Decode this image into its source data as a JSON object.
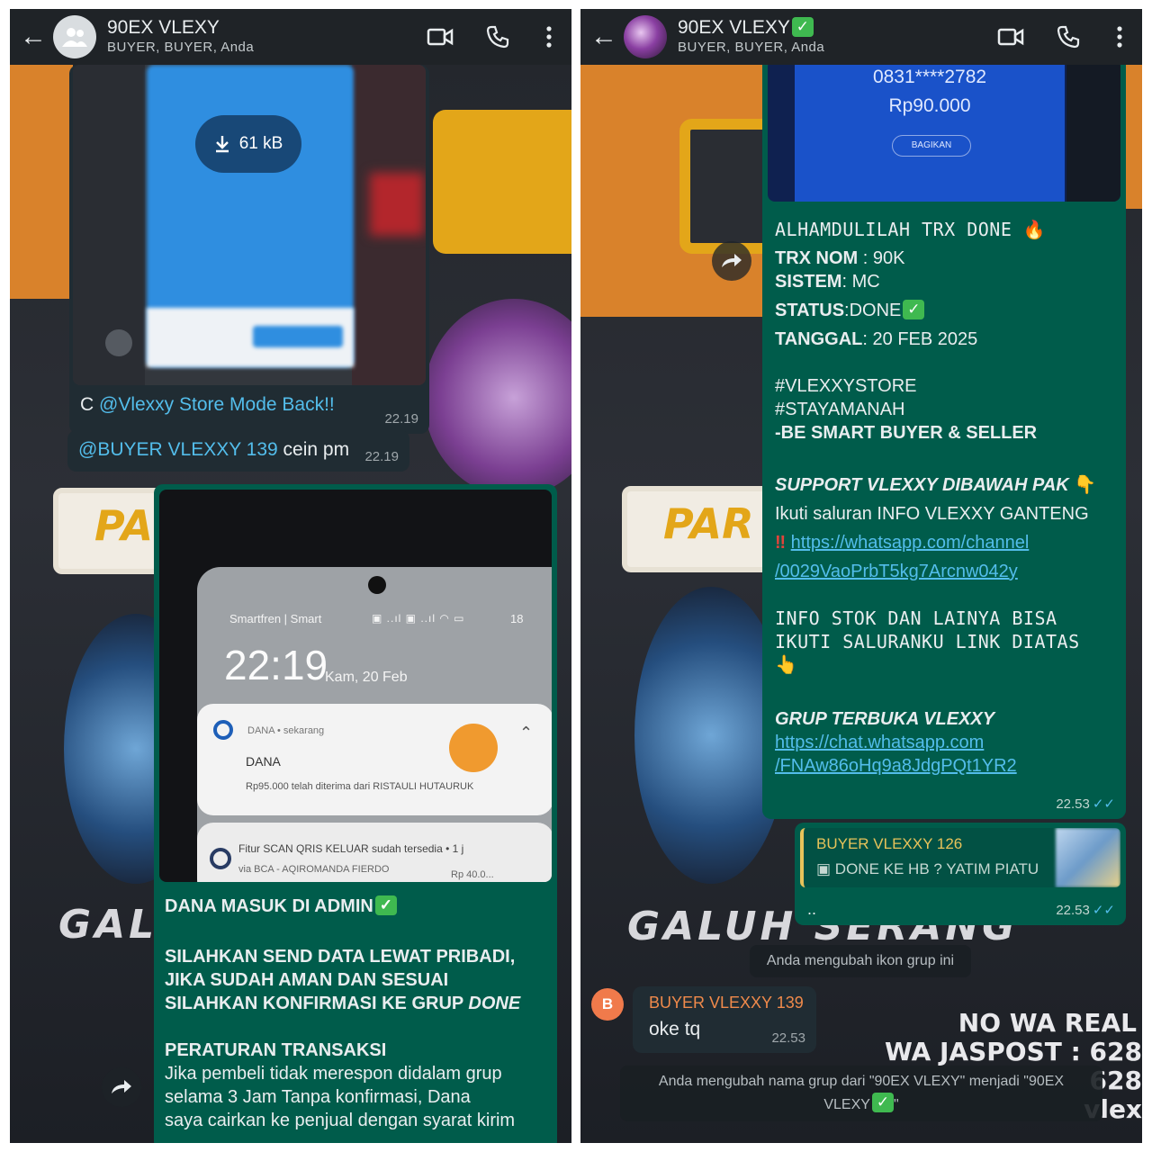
{
  "left": {
    "header": {
      "title": "90EX VLEXY",
      "subtitle": "BUYER, BUYER, Anda"
    },
    "messages": {
      "image_download_size": "61 kB",
      "caption_prefix": "C ",
      "caption_mention": "@Vlexxy Store Mode Back!!",
      "caption_time": "22.19",
      "m2_mention": "@BUYER VLEXXY 139",
      "m2_text": " cein pm",
      "m2_time": "22.19"
    },
    "screenshot": {
      "carrier": "Smartfren | Smart",
      "battery": "18",
      "clock": "22:19",
      "date": "Kam, 20 Feb",
      "notif1_app": "DANA • sekarang",
      "notif1_title": "DANA",
      "notif1_body": "Rp95.000 telah diterima dari RISTAULI HUTAURUK",
      "notif2_title": "Fitur SCAN QRIS KELUAR sudah tersedia",
      "notif2_meta": "• 1 j",
      "notif2_body": "via BCA - AQIROMANDA FIERDO",
      "notif2_amount": "Rp 40.0..."
    },
    "caption": {
      "line1": "DANA MASUK DI ADMIN",
      "line2": "SILAHKAN SEND DATA LEWAT PRIBADI,",
      "line3": "JIKA SUDAH AMAN DAN SESUAI",
      "line4a": "SILAHKAN KONFIRMASI KE GRUP ",
      "line4b": "DONE",
      "line5": "PERATURAN TRANSAKSI",
      "line6": "Jika pembeli tidak merespon didalam grup",
      "line7": "selama 3 Jam Tanpa konfirmasi, Dana",
      "line8": "saya cairkan ke penjual dengan syarat kirim"
    },
    "wallpaper": {
      "banner": "PAR",
      "big": "GALU"
    }
  },
  "right": {
    "header": {
      "title": "90EX VLEXY",
      "subtitle": "BUYER, BUYER, Anda"
    },
    "receipt": {
      "phone": "0831****2782",
      "amount": "Rp90.000",
      "share": "BAGIKAN"
    },
    "post": {
      "l1": "ALHAMDULILAH TRX DONE",
      "trx_label": "TRX NOM",
      "trx_val": " : 90K",
      "sistem_label": "SISTEM",
      "sistem_val": ": MC",
      "status_label": "STATUS",
      "status_val": ":DONE",
      "tanggal_label": "TANGGAL",
      "tanggal_val": ": 20 FEB 2025",
      "tag1": "#VLEXXYSTORE",
      "tag2": "#STAYAMANAH",
      "smart": "-BE SMART BUYER & SELLER",
      "support": "SUPPORT VLEXXY DIBAWAH PAK",
      "ikuti": "Ikuti saluran INFO VLEXXY GANTENG",
      "link1a": "https://whatsapp.com/channel",
      "link1b": "/0029VaoPrbT5kg7Arcnw042y",
      "info1": "INFO STOK DAN LAINYA BISA",
      "info2": "IKUTI SALURANKU LINK DIATAS",
      "grup": "GRUP TERBUKA VLEXXY",
      "link2a": "https://chat.whatsapp.com",
      "link2b": "/FNAw86oHq9a8JdgPQt1YR2",
      "time": "22.53"
    },
    "reply": {
      "quoted_author": "BUYER VLEXXY 126",
      "quoted_text": "DONE KE HB ? YATIM PIATU",
      "text": "..",
      "time": "22.53"
    },
    "system1": "Anda mengubah ikon grup ini",
    "incoming": {
      "avatar_letter": "B",
      "author": "BUYER VLEXXY 139",
      "text": "oke tq",
      "time": "22.53"
    },
    "system2a": "Anda mengubah nama grup dari \"90EX VLEXY\" menjadi \"90EX",
    "system2b": "VLEXY",
    "system2c": "\"",
    "wallpaper": {
      "banner": "PAR",
      "big": "GALUH SERANG",
      "t1": "NO WA REAL",
      "t2": "WA JASPOST : 628",
      "t3": "628",
      "t4": "vlex"
    }
  },
  "colors": {
    "outgoing_bubble": "#005c4b",
    "incoming_bubble": "#202c33",
    "header": "#1f2327",
    "link": "#53bdeb",
    "author_orange": "#f08a4b",
    "quoted_author": "#e8c35a"
  }
}
